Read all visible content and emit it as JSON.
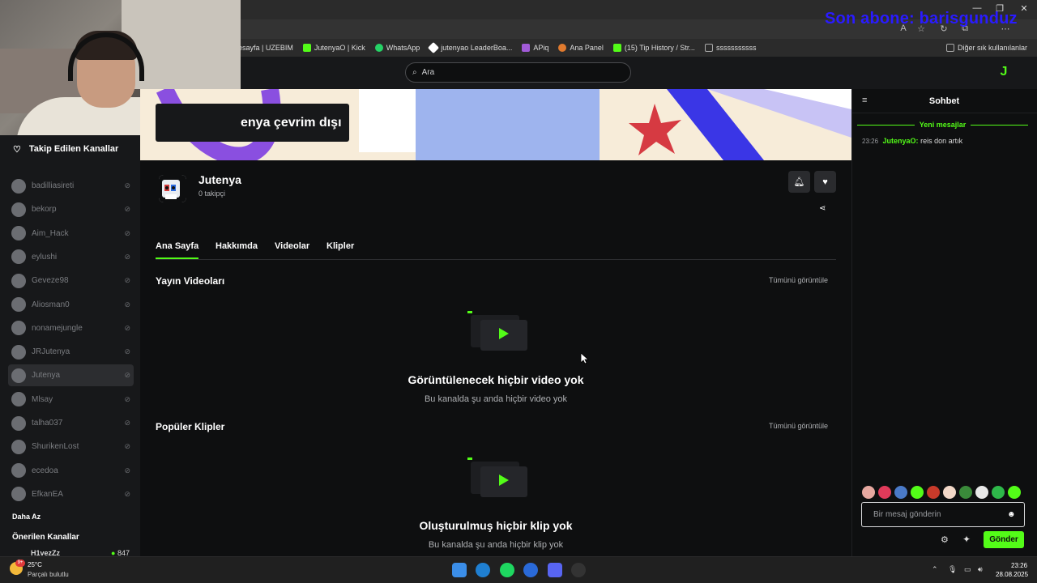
{
  "overlay": {
    "subscriber_text": "Son abone: barisgunduz"
  },
  "bookmarks": [
    {
      "label": "esayfa | UZEBIM",
      "color": "#d04b3a"
    },
    {
      "label": "JutenyaO | Kick",
      "color": "#53fc18"
    },
    {
      "label": "WhatsApp",
      "color": "#25d366"
    },
    {
      "label": "jutenyao LeaderBoa...",
      "color": "#ffffff"
    },
    {
      "label": "APiq",
      "color": "#a15bd8"
    },
    {
      "label": "Ana Panel",
      "color": "#e07a2e"
    },
    {
      "label": "(15) Tip History / Str...",
      "color": "#53fc18"
    },
    {
      "label": "sssssssssss",
      "color": "#888888"
    }
  ],
  "bookmarks_other": "Diğer sık kullanılanlar",
  "search": {
    "placeholder": "Ara"
  },
  "sidebar": {
    "followed_title": "Takip Edilen Kanallar",
    "channels": [
      {
        "name": "badilliasireti",
        "active": false
      },
      {
        "name": "bekorp",
        "active": false
      },
      {
        "name": "Aim_Hack",
        "active": false
      },
      {
        "name": "eylushi",
        "active": false
      },
      {
        "name": "Geveze98",
        "active": false
      },
      {
        "name": "Aliosman0",
        "active": false
      },
      {
        "name": "nonamejungle",
        "active": false
      },
      {
        "name": "JRJutenya",
        "active": false
      },
      {
        "name": "Jutenya",
        "active": true
      },
      {
        "name": "Mlsay",
        "active": false
      },
      {
        "name": "talha037",
        "active": false
      },
      {
        "name": "ShurikenLost",
        "active": false
      },
      {
        "name": "ecedoa",
        "active": false
      },
      {
        "name": "EfkanEA",
        "active": false
      }
    ],
    "less": "Daha Az",
    "recommended_title": "Önerilen Kanallar",
    "recommended_item": "H1vezZz",
    "recommended_count": "847"
  },
  "banner": {
    "offline_text": "enya çevrim dışı"
  },
  "channel": {
    "name": "Jutenya",
    "followers": "0 takipçi"
  },
  "tabs": [
    "Ana Sayfa",
    "Hakkımda",
    "Videolar",
    "Klipler"
  ],
  "sections": {
    "videos": {
      "title": "Yayın Videoları",
      "see_all": "Tümünü görüntüle",
      "empty_title": "Görüntülenecek hiçbir video yok",
      "empty_sub": "Bu kanalda şu anda hiçbir video yok"
    },
    "clips": {
      "title": "Popüler Klipler",
      "see_all": "Tümünü görüntüle",
      "empty_title": "Oluşturulmuş hiçbir klip yok",
      "empty_sub": "Bu kanalda şu anda hiçbir klip yok"
    }
  },
  "chat": {
    "title": "Sohbet",
    "new_messages": "Yeni mesajlar",
    "message": {
      "time": "23:26",
      "user": "JutenyaO:",
      "text": "reis don artık"
    },
    "input_placeholder": "Bir mesaj gönderin",
    "send": "Gönder"
  },
  "taskbar": {
    "weather_temp": "25°C",
    "weather_desc": "Parçalı bulutlu",
    "weather_badge": "9+",
    "time": "23:26",
    "date": "28.08.2025"
  },
  "colors": {
    "accent": "#53fc18",
    "bg": "#0e0f10",
    "panel": "#17181a",
    "overlay_text": "#2a1bff"
  }
}
